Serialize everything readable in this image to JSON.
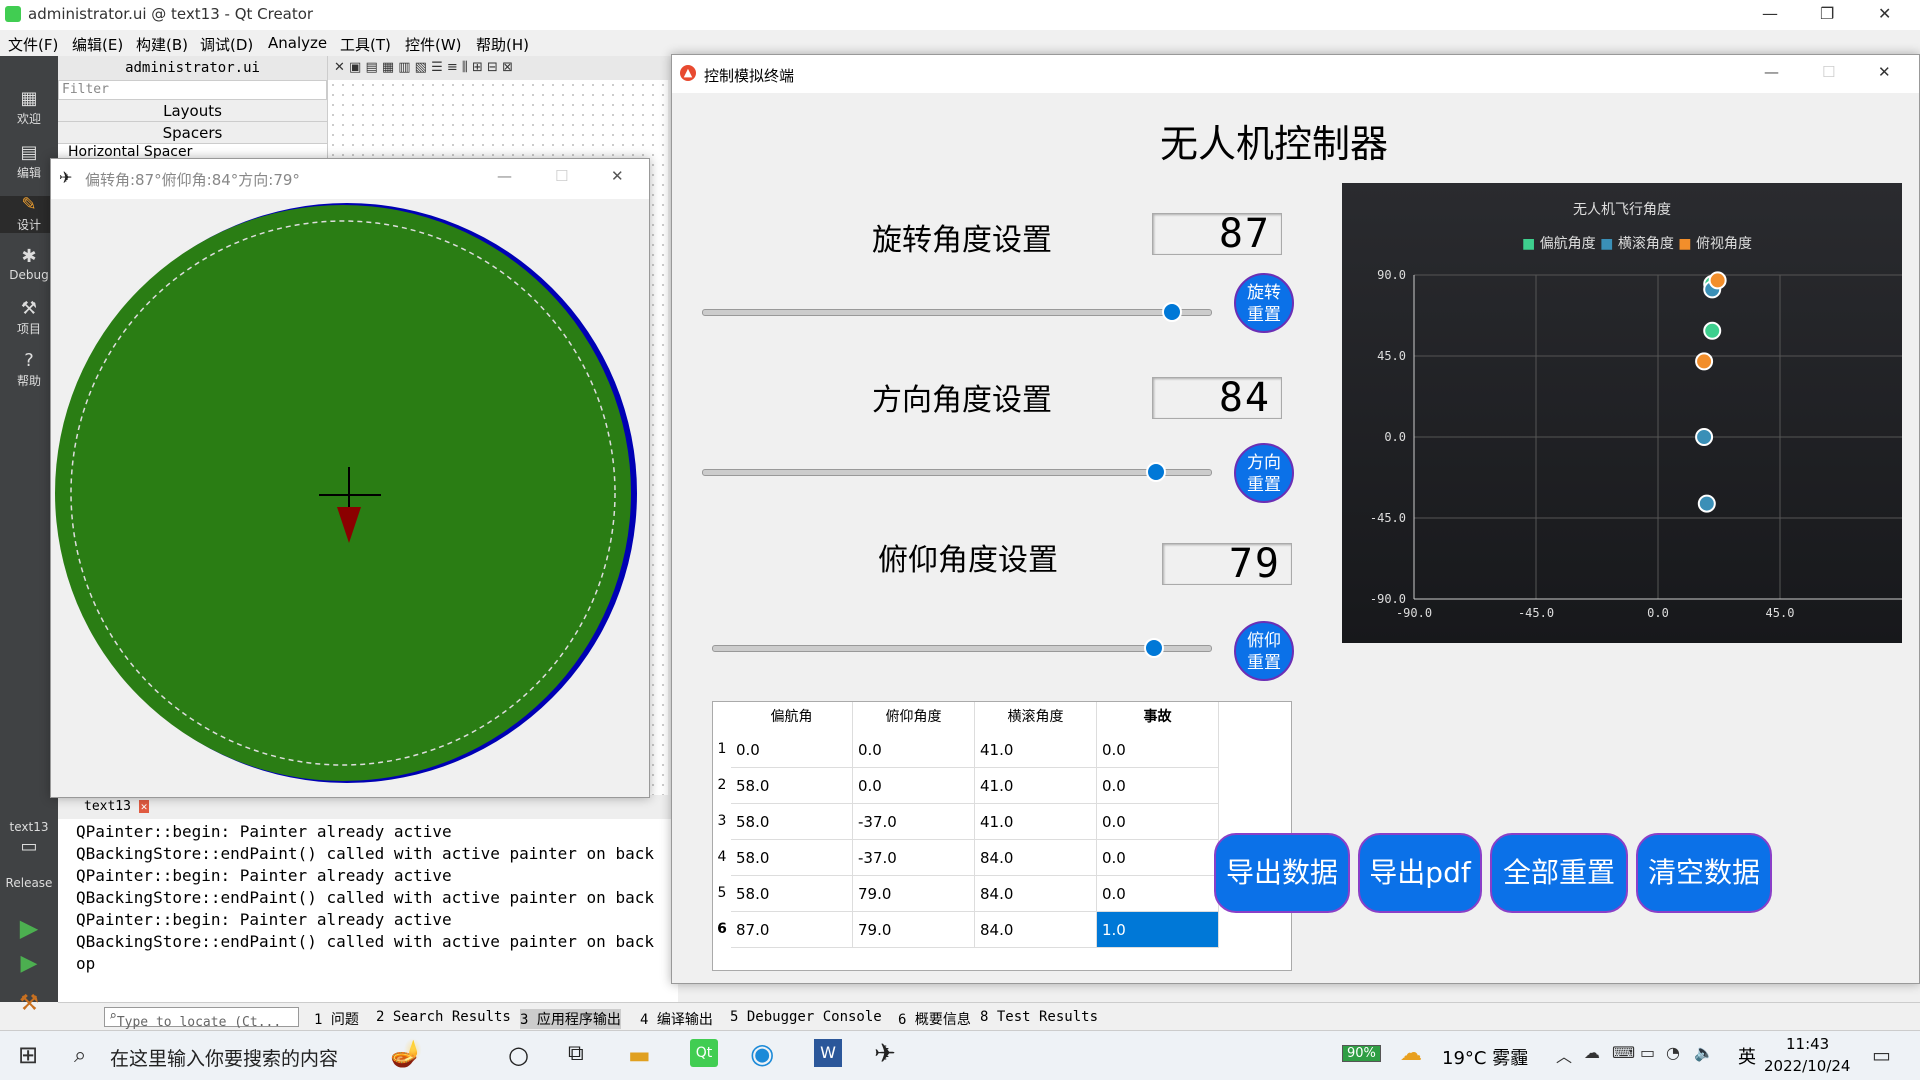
{
  "qt": {
    "window_title": "administrator.ui @ text13 - Qt Creator",
    "menus": [
      "文件(F)",
      "编辑(E)",
      "构建(B)",
      "调试(D)",
      "Analyze",
      "工具(T)",
      "控件(W)",
      "帮助(H)"
    ],
    "file_tab": "administrator.ui",
    "filter_placeholder": "Filter",
    "tree": [
      "Layouts",
      "Spacers",
      "Horizontal Spacer"
    ],
    "sidebar": [
      "欢迎",
      "编辑",
      "设计",
      "Debug",
      "项目",
      "帮助"
    ],
    "kit": {
      "project": "text13",
      "mode": "Release"
    },
    "output_tab": "text13",
    "output_lines": [
      "QPainter::begin: Painter already active",
      "QBackingStore::endPaint() called with active painter on back",
      "QPainter::begin: Painter already active",
      "QBackingStore::endPaint() called with active painter on back",
      "QPainter::begin: Painter already active",
      "QBackingStore::endPaint() called with active painter on back",
      "op"
    ],
    "status_tabs": [
      "1 问题",
      "2 Search Results",
      "3 应用程序输出",
      "4 编译输出",
      "5 Debugger Console",
      "6 概要信息",
      "8 Test Results"
    ],
    "locate_placeholder": "Type to locate (Ct..."
  },
  "drone": {
    "title": "偏转角:87°俯仰角:84°方向:79°",
    "disc_color": "#2a7d14",
    "rim_color": "#0000b4",
    "arrow_color": "#8b0000"
  },
  "ctrl": {
    "title": "控制模拟终端",
    "heading": "无人机控制器",
    "rotate_label": "旋转角度设置",
    "rotate_value": "87",
    "rotate_reset": [
      "旋转",
      "重置"
    ],
    "rotate_slider": 0.87,
    "dir_label": "方向角度设置",
    "dir_value": "84",
    "dir_reset": [
      "方向",
      "重置"
    ],
    "dir_slider": 0.84,
    "pitch_label": "俯仰角度设置",
    "pitch_value": "79",
    "pitch_reset": [
      "俯仰",
      "重置"
    ],
    "pitch_slider": 0.79,
    "table": {
      "headers": [
        "偏航角",
        "俯仰角度",
        "横滚角度",
        "事故"
      ],
      "rows": [
        [
          "1",
          "0.0",
          "0.0",
          "41.0",
          "0.0"
        ],
        [
          "2",
          "58.0",
          "0.0",
          "41.0",
          "0.0"
        ],
        [
          "3",
          "58.0",
          "-37.0",
          "41.0",
          "0.0"
        ],
        [
          "4",
          "58.0",
          "-37.0",
          "84.0",
          "0.0"
        ],
        [
          "5",
          "58.0",
          "79.0",
          "84.0",
          "0.0"
        ],
        [
          "6",
          "87.0",
          "79.0",
          "84.0",
          "1.0"
        ]
      ]
    },
    "buttons": [
      "导出数据",
      "导出pdf",
      "全部重置",
      "清空数据"
    ]
  },
  "chart_data": {
    "type": "scatter",
    "title": "无人机飞行角度",
    "legend": [
      "偏航角度",
      "横滚角度",
      "俯视角度"
    ],
    "legend_colors": [
      "#3ecf8e",
      "#3a8fb7",
      "#f28e2b"
    ],
    "xlim": [
      -90,
      90
    ],
    "ylim": [
      -90,
      90
    ],
    "xticks": [
      "-90.0",
      "-45.0",
      "0.0",
      "45.0"
    ],
    "yticks": [
      "90.0",
      "45.0",
      "0.0",
      "-45.0",
      "-90.0"
    ],
    "series": [
      {
        "name": "偏航角度",
        "points": [
          [
            20,
            85
          ],
          [
            20,
            59
          ]
        ]
      },
      {
        "name": "横滚角度",
        "points": [
          [
            20,
            82
          ],
          [
            17,
            0
          ],
          [
            18,
            -37
          ]
        ]
      },
      {
        "name": "俯视角度",
        "points": [
          [
            22,
            87
          ],
          [
            17,
            42
          ]
        ]
      }
    ]
  },
  "taskbar": {
    "search": "在这里输入你要搜索的内容",
    "battery": "90%",
    "weather": "19°C 雾霾",
    "ime": "英",
    "time": "11:43",
    "date": "2022/10/24"
  }
}
